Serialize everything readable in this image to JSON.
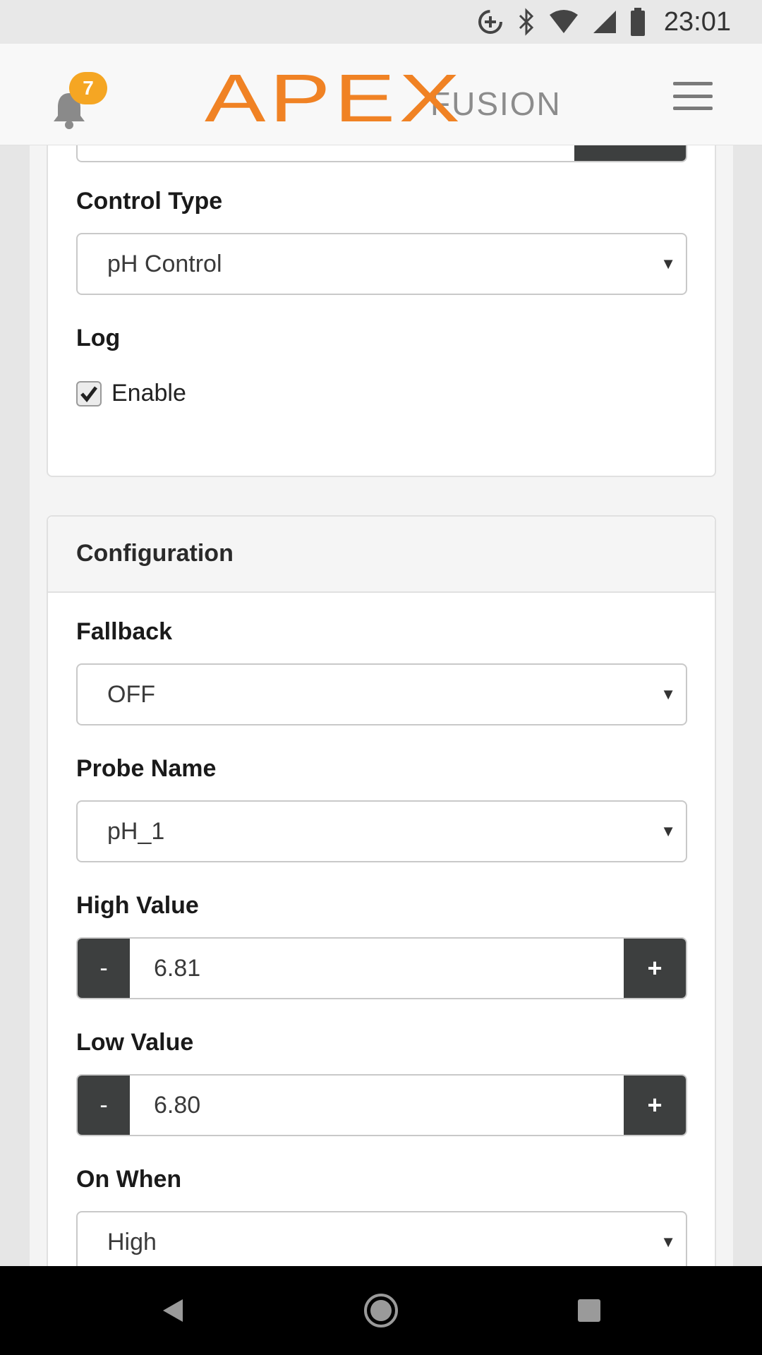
{
  "status_bar": {
    "time": "23:01",
    "icons": [
      "data-saver-icon",
      "bluetooth-icon",
      "wifi-icon",
      "cell-signal-icon",
      "battery-icon"
    ]
  },
  "header": {
    "notification_count": "7",
    "logo_primary": "APEX",
    "logo_secondary": "FUSION",
    "brand_color": "#f08224",
    "badge_color": "#f5a623"
  },
  "general": {
    "control_type_label": "Control Type",
    "control_type_value": "pH Control",
    "log_label": "Log",
    "log_enable_label": "Enable",
    "log_enabled": true
  },
  "configuration": {
    "title": "Configuration",
    "fallback_label": "Fallback",
    "fallback_value": "OFF",
    "probe_name_label": "Probe Name",
    "probe_name_value": "pH_1",
    "high_value_label": "High Value",
    "high_value": "6.81",
    "low_value_label": "Low Value",
    "low_value": "6.80",
    "on_when_label": "On When",
    "on_when_value": "High",
    "decrement_label": "-",
    "increment_label": "+"
  }
}
